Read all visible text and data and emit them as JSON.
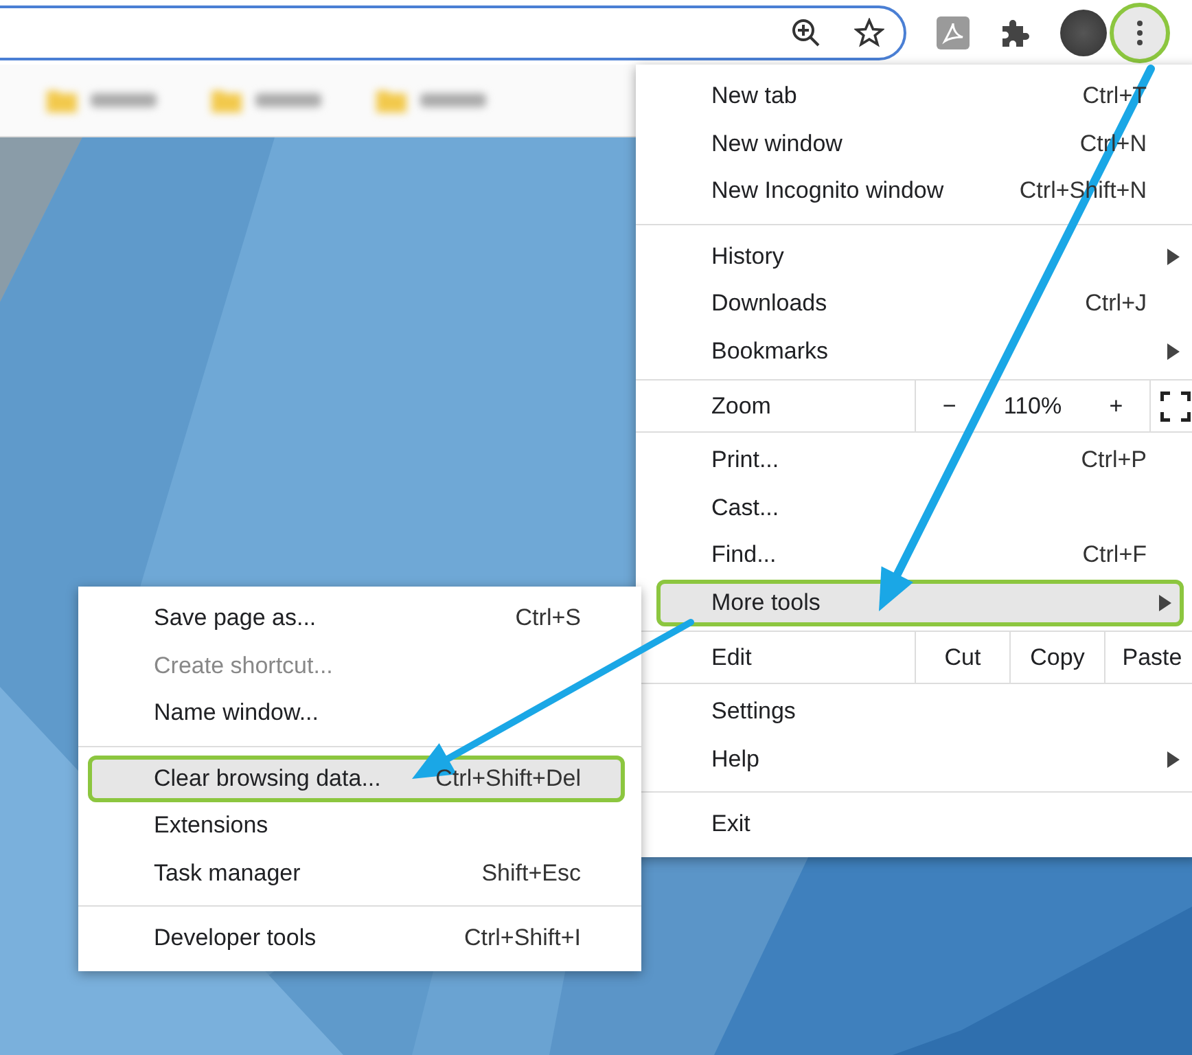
{
  "toolbar": {
    "menu_button": {
      "selected": true
    }
  },
  "bookmarks": [
    {
      "kind": "folder"
    },
    {
      "kind": "folder"
    },
    {
      "kind": "folder"
    }
  ],
  "menu": {
    "items": [
      {
        "kind": "item",
        "label": "New tab",
        "shortcut": "Ctrl+T",
        "submenu": false,
        "selected": false
      },
      {
        "kind": "item",
        "label": "New window",
        "shortcut": "Ctrl+N",
        "submenu": false,
        "selected": false
      },
      {
        "kind": "item",
        "label": "New Incognito window",
        "shortcut": "Ctrl+Shift+N",
        "submenu": false,
        "selected": false
      },
      {
        "kind": "separator"
      },
      {
        "kind": "item",
        "label": "History",
        "submenu": true,
        "selected": false
      },
      {
        "kind": "item",
        "label": "Downloads",
        "shortcut": "Ctrl+J",
        "submenu": false,
        "selected": false
      },
      {
        "kind": "item",
        "label": "Bookmarks",
        "submenu": true,
        "selected": false
      },
      {
        "kind": "zoom",
        "label": "Zoom",
        "minus": "−",
        "value": "110%",
        "plus": "+"
      },
      {
        "kind": "item",
        "label": "Print...",
        "shortcut": "Ctrl+P",
        "submenu": false,
        "selected": false
      },
      {
        "kind": "item",
        "label": "Cast...",
        "submenu": false,
        "selected": false
      },
      {
        "kind": "item",
        "label": "Find...",
        "shortcut": "Ctrl+F",
        "submenu": false,
        "selected": false
      },
      {
        "kind": "item",
        "label": "More tools",
        "submenu": true,
        "selected": true
      },
      {
        "kind": "edit",
        "label": "Edit",
        "buttons": [
          "Cut",
          "Copy",
          "Paste"
        ]
      },
      {
        "kind": "item",
        "label": "Settings",
        "submenu": false,
        "selected": false
      },
      {
        "kind": "item",
        "label": "Help",
        "submenu": true,
        "selected": false
      },
      {
        "kind": "separator"
      },
      {
        "kind": "item",
        "label": "Exit",
        "submenu": false,
        "selected": false
      }
    ]
  },
  "submenu": {
    "items": [
      {
        "kind": "item",
        "label": "Save page as...",
        "shortcut": "Ctrl+S",
        "disabled": false,
        "selected": false
      },
      {
        "kind": "item",
        "label": "Create shortcut...",
        "disabled": true,
        "selected": false
      },
      {
        "kind": "item",
        "label": "Name window...",
        "disabled": false,
        "selected": false
      },
      {
        "kind": "separator"
      },
      {
        "kind": "item",
        "label": "Clear browsing data...",
        "shortcut": "Ctrl+Shift+Del",
        "disabled": false,
        "selected": true
      },
      {
        "kind": "item",
        "label": "Extensions",
        "disabled": false,
        "selected": false
      },
      {
        "kind": "item",
        "label": "Task manager",
        "shortcut": "Shift+Esc",
        "disabled": false,
        "selected": false
      },
      {
        "kind": "separator"
      },
      {
        "kind": "item",
        "label": "Developer tools",
        "shortcut": "Ctrl+Shift+I",
        "disabled": false,
        "selected": false
      }
    ]
  }
}
